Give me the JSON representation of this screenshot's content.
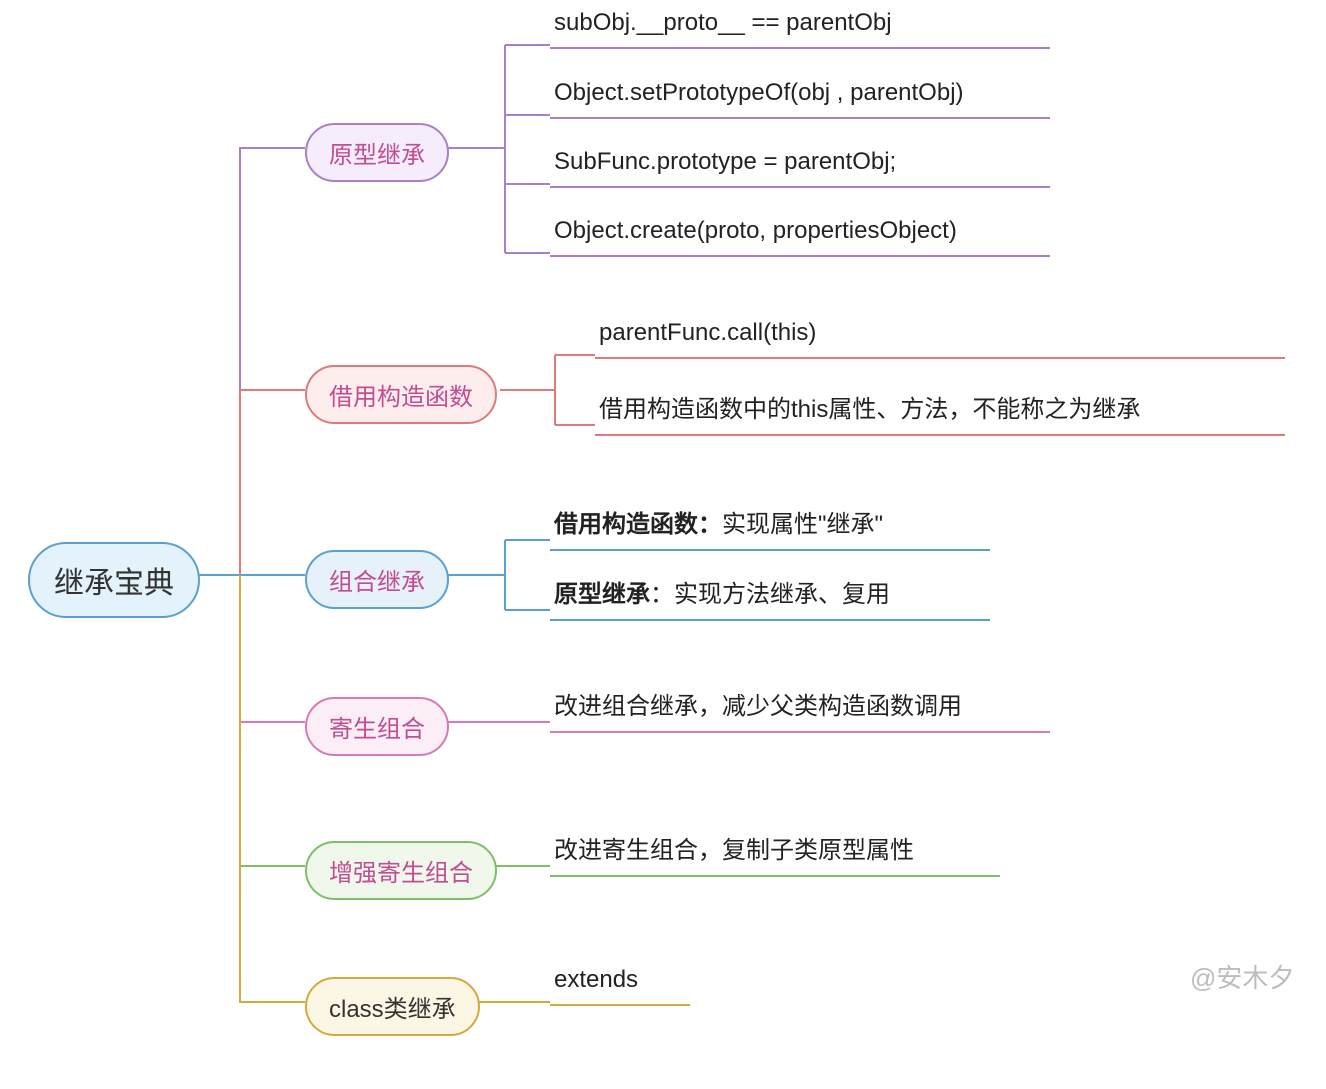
{
  "root": {
    "label": "继承宝典"
  },
  "branches": [
    {
      "key": "proto",
      "label": "原型继承",
      "leaves": [
        "subObj.__proto__ == parentObj",
        "Object.setPrototypeOf(obj , parentObj)",
        "SubFunc.prototype = parentObj;",
        "Object.create(proto, propertiesObject)"
      ]
    },
    {
      "key": "borrow",
      "label": "借用构造函数",
      "leaves": [
        "parentFunc.call(this)",
        "借用构造函数中的this属性、方法，不能称之为继承"
      ]
    },
    {
      "key": "combo",
      "label": "组合继承",
      "leaves_rich": [
        {
          "bold": "借用构造函数：",
          "rest": "实现属性\"继承\""
        },
        {
          "bold": "原型继承",
          "rest": "：实现方法继承、复用"
        }
      ]
    },
    {
      "key": "parasitic",
      "label": "寄生组合",
      "leaves": [
        "改进组合继承，减少父类构造函数调用"
      ]
    },
    {
      "key": "enhanced",
      "label": "增强寄生组合",
      "leaves": [
        "改进寄生组合，复制子类原型属性"
      ]
    },
    {
      "key": "class",
      "label": "class类继承",
      "leaves": [
        "extends"
      ]
    }
  ],
  "watermark": "@安木夕"
}
